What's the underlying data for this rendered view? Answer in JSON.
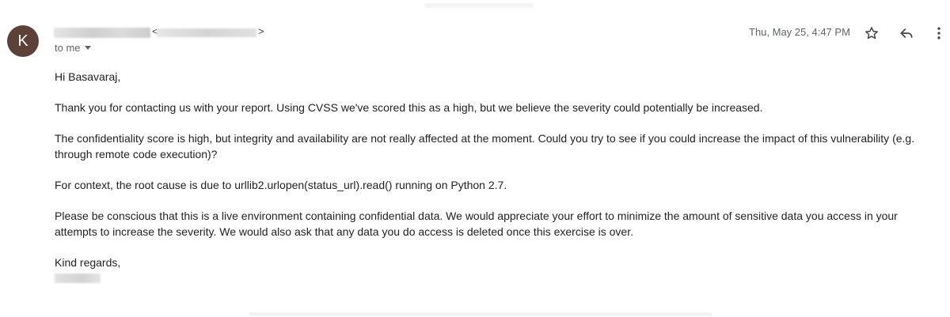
{
  "header": {
    "avatar_letter": "K",
    "avatar_color": "#5d4037",
    "sender_open": "<",
    "sender_close": ">",
    "recipient_label": "to me",
    "date": "Thu, May 25, 4:47 PM"
  },
  "actions": {
    "star_icon": "star-icon",
    "reply_icon": "reply-icon",
    "more_icon": "more-vert-icon"
  },
  "message": {
    "greeting": "Hi Basavaraj,",
    "paragraphs": [
      "Thank you for contacting us with your report. Using CVSS we've scored this as a high, but we believe the severity could potentially be increased.",
      "The confidentiality score is high, but integrity and availability are not really affected at the moment. Could you try to see if you could increase the impact of this vulnerability (e.g. through remote code execution)?",
      "For context, the root cause is due to urllib2.urlopen(status_url).read() running on Python 2.7.",
      "Please be conscious that this is a live environment containing confidential data. We would appreciate your effort to minimize the amount of sensitive data you access in your attempts to increase the severity. We would also ask that any data you do access is deleted once this exercise is over."
    ],
    "closing": "Kind regards,"
  }
}
